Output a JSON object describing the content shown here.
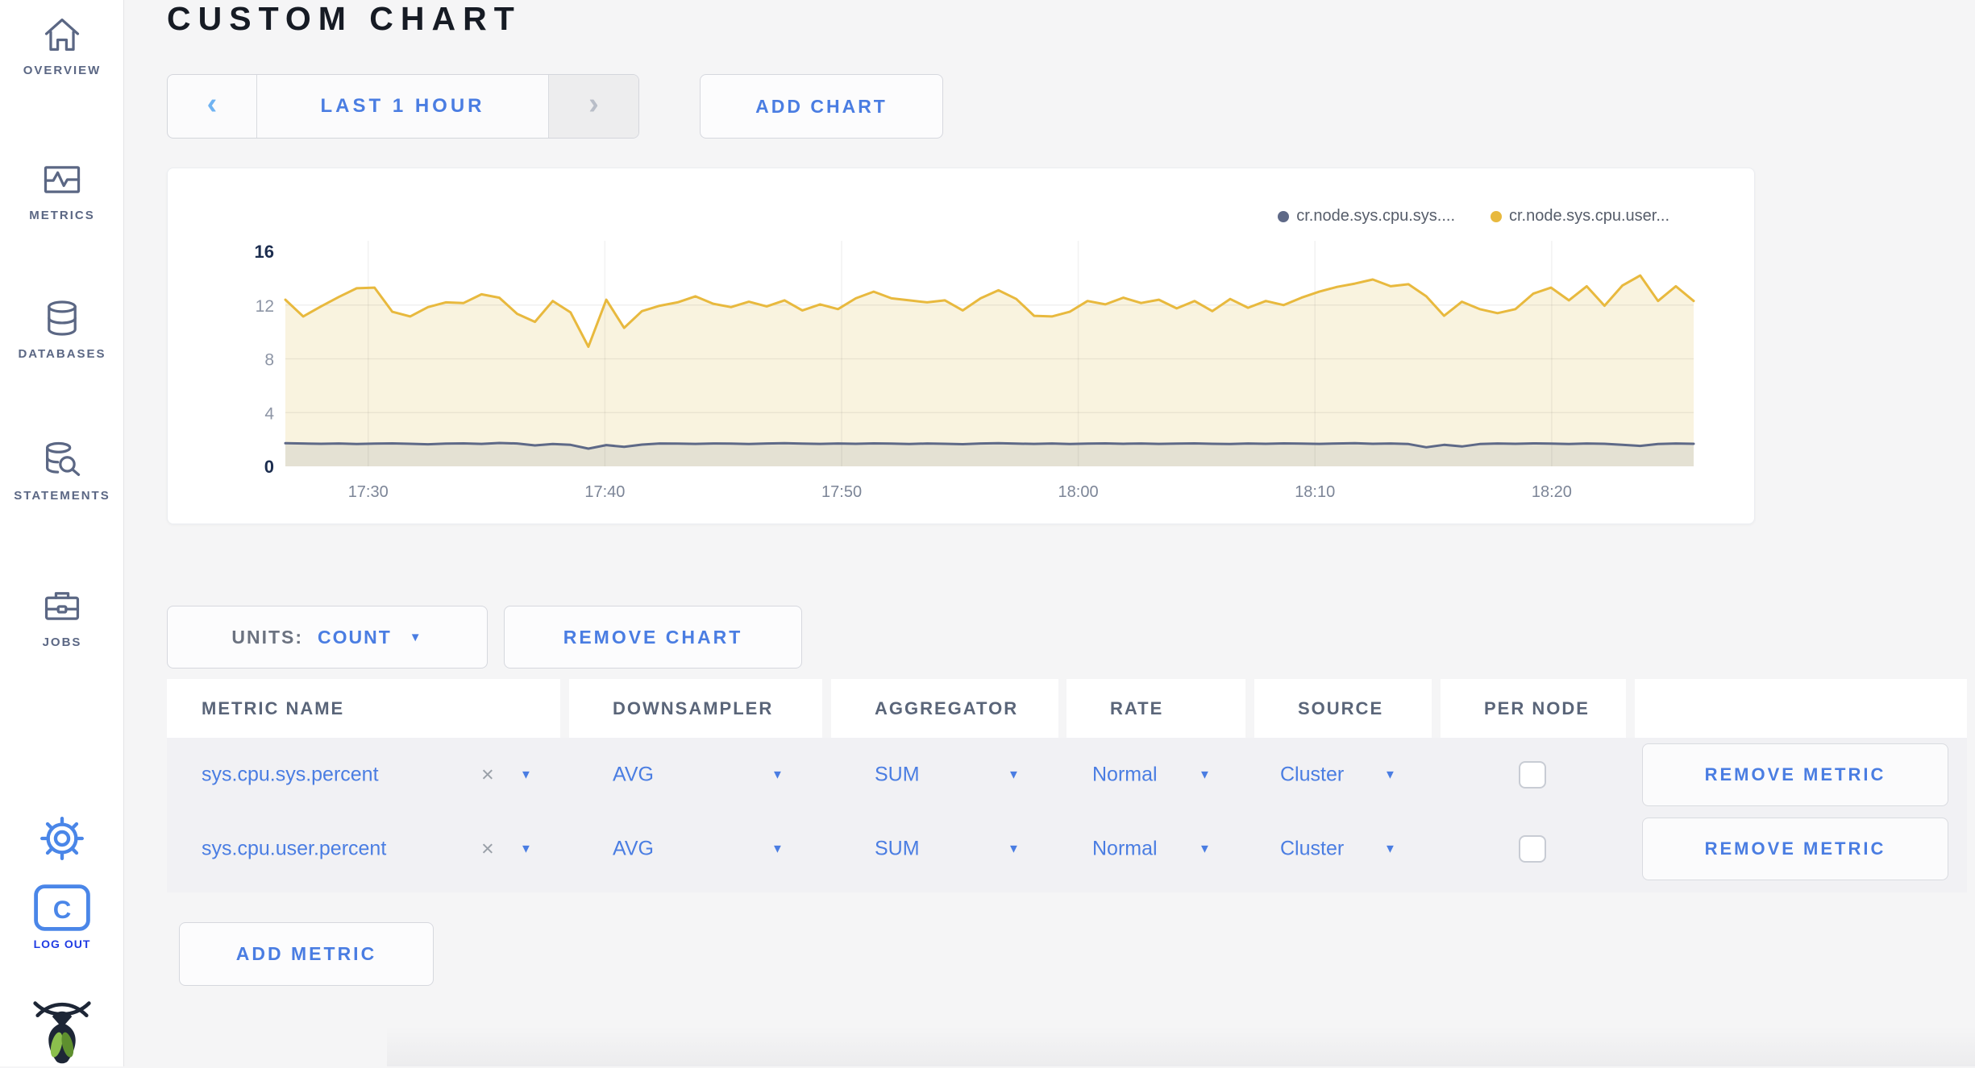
{
  "colors": {
    "accent": "#4a7de2",
    "logout_blue": "#1f3be3",
    "icon_slate": "#5b6784",
    "disabled_segment_bg": "#ededee"
  },
  "sidebar": {
    "items": [
      {
        "label": "OVERVIEW",
        "icon": "home-icon"
      },
      {
        "label": "METRICS",
        "icon": "metrics-chart-icon"
      },
      {
        "label": "DATABASES",
        "icon": "database-icon"
      },
      {
        "label": "STATEMENTS",
        "icon": "database-search-icon"
      },
      {
        "label": "JOBS",
        "icon": "briefcase-icon"
      }
    ],
    "settings_icon": "gear-icon",
    "logout": {
      "label": "LOG OUT",
      "icon": "c-logo-icon"
    },
    "brand_icon": "cockroach-bug-logo"
  },
  "header": {
    "title": "CUSTOM CHART"
  },
  "time_nav": {
    "prev": "‹",
    "range_label": "LAST 1 HOUR",
    "next": "›"
  },
  "buttons": {
    "add_chart": "ADD CHART",
    "remove_chart": "REMOVE CHART",
    "add_metric": "ADD METRIC"
  },
  "units": {
    "prefix": "UNITS:",
    "value": "COUNT"
  },
  "chart_data": {
    "type": "line",
    "title": "",
    "xlabel": "",
    "ylabel": "",
    "ylim": [
      0,
      16
    ],
    "y_ticks": [
      16,
      12,
      8,
      4,
      0
    ],
    "grid_values": [
      4,
      8,
      12
    ],
    "x_ticks": [
      "17:30",
      "17:40",
      "17:50",
      "18:00",
      "18:10",
      "18:20"
    ],
    "tick_fracs": [
      0.0588,
      0.2269,
      0.395,
      0.563,
      0.7311,
      0.8992
    ],
    "legend_position": "top-right",
    "grid": true,
    "series": [
      {
        "name": "cr.node.sys.cpu.sys....",
        "color": "#5e6987",
        "fill": "rgba(94,105,135,0.13)",
        "values": [
          1.72,
          1.7,
          1.68,
          1.7,
          1.66,
          1.69,
          1.71,
          1.68,
          1.64,
          1.69,
          1.71,
          1.67,
          1.74,
          1.7,
          1.56,
          1.66,
          1.6,
          1.32,
          1.58,
          1.45,
          1.62,
          1.7,
          1.69,
          1.67,
          1.7,
          1.69,
          1.66,
          1.7,
          1.72,
          1.69,
          1.67,
          1.7,
          1.68,
          1.71,
          1.69,
          1.66,
          1.7,
          1.68,
          1.65,
          1.7,
          1.72,
          1.69,
          1.67,
          1.7,
          1.66,
          1.69,
          1.71,
          1.68,
          1.7,
          1.67,
          1.69,
          1.71,
          1.68,
          1.66,
          1.7,
          1.68,
          1.71,
          1.69,
          1.67,
          1.7,
          1.72,
          1.68,
          1.7,
          1.66,
          1.42,
          1.6,
          1.48,
          1.66,
          1.7,
          1.68,
          1.71,
          1.69,
          1.66,
          1.7,
          1.68,
          1.6,
          1.52,
          1.66,
          1.7,
          1.68
        ]
      },
      {
        "name": "cr.node.sys.cpu.user...",
        "color": "#e8b93e",
        "fill": "rgba(249,242,220,0.92)",
        "values": [
          12.4,
          11.15,
          11.9,
          12.6,
          13.25,
          13.3,
          11.5,
          11.15,
          11.85,
          12.2,
          12.15,
          12.8,
          12.55,
          11.35,
          10.75,
          12.3,
          11.45,
          8.9,
          12.4,
          10.3,
          11.55,
          11.95,
          12.2,
          12.65,
          12.1,
          11.85,
          12.25,
          11.9,
          12.35,
          11.6,
          12.05,
          11.7,
          12.5,
          13.0,
          12.5,
          12.35,
          12.2,
          12.35,
          11.6,
          12.5,
          13.1,
          12.45,
          11.2,
          11.15,
          11.5,
          12.3,
          12.05,
          12.55,
          12.15,
          12.4,
          11.75,
          12.3,
          11.55,
          12.45,
          11.8,
          12.3,
          12.0,
          12.55,
          13.0,
          13.35,
          13.6,
          13.9,
          13.4,
          13.55,
          12.65,
          11.2,
          12.25,
          11.7,
          11.4,
          11.7,
          12.85,
          13.3,
          12.35,
          13.4,
          11.95,
          13.45,
          14.2,
          12.3,
          13.4,
          12.3
        ]
      }
    ]
  },
  "table": {
    "columns": [
      "METRIC NAME",
      "DOWNSAMPLER",
      "AGGREGATOR",
      "RATE",
      "SOURCE",
      "PER NODE",
      ""
    ],
    "rows": [
      {
        "metric": "sys.cpu.sys.percent",
        "clear": "×",
        "downsampler": "AVG",
        "aggregator": "SUM",
        "rate": "Normal",
        "source": "Cluster",
        "per_node": false,
        "remove_label": "REMOVE METRIC"
      },
      {
        "metric": "sys.cpu.user.percent",
        "clear": "×",
        "downsampler": "AVG",
        "aggregator": "SUM",
        "rate": "Normal",
        "source": "Cluster",
        "per_node": false,
        "remove_label": "REMOVE METRIC"
      }
    ]
  }
}
